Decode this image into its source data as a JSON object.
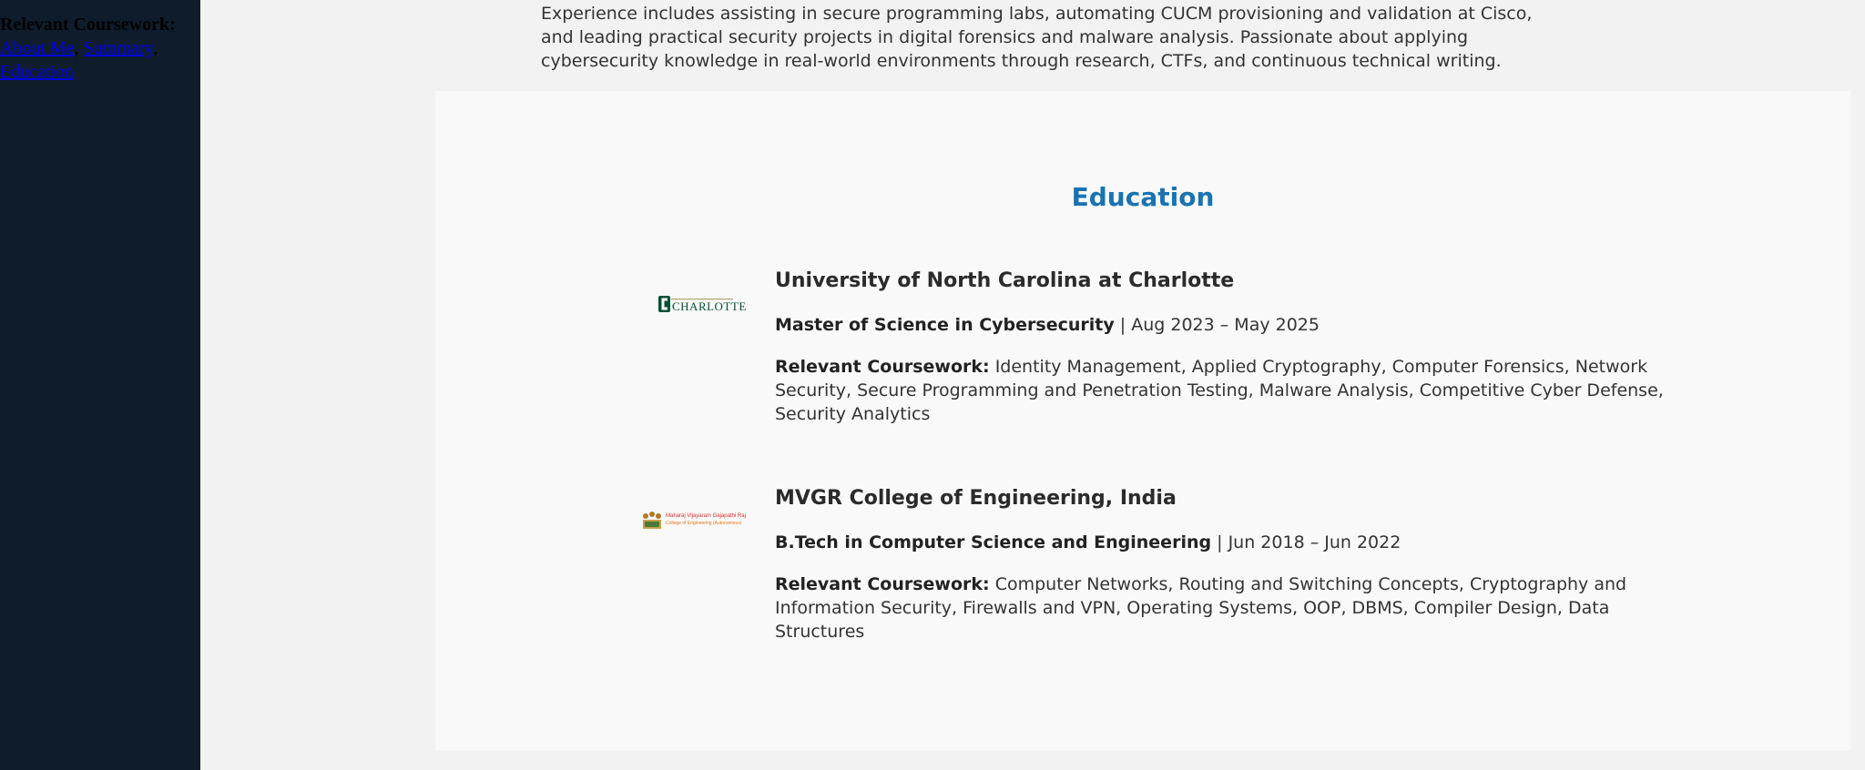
{
  "sidebar": {
    "heading": "Relevant Coursework:",
    "links": [
      {
        "label": "About Me"
      },
      {
        "label": "Summary"
      },
      {
        "label": "Education"
      }
    ],
    "separator": ","
  },
  "summary": {
    "text_tail": "Experience includes assisting in secure programming labs, automating CUCM provisioning and validation at Cisco, and leading practical security projects in digital forensics and malware analysis. Passionate about applying cybersecurity knowledge in real-world environments through research, CTFs, and continuous technical writing."
  },
  "education": {
    "title": "Education",
    "entries": [
      {
        "logo_text": "CHARLOTTE",
        "school": "University of North Carolina at Charlotte",
        "degree": "Master of Science in Cybersecurity",
        "dates": "| Aug 2023 – May 2025",
        "coursework_label": "Relevant Coursework:",
        "coursework": "Identity Management, Applied Cryptography, Computer Forensics, Network Security, Secure Programming and Penetration Testing, Malware Analysis, Competitive Cyber Defense, Security Analytics"
      },
      {
        "logo_text_line1": "Maharaj Vijayaram Gajapathi Raj",
        "logo_text_line2": "College of Engineering (Autonomous)",
        "school": "MVGR College of Engineering, India",
        "degree": "B.Tech in Computer Science and Engineering",
        "dates": "| Jun 2018 – Jun 2022",
        "coursework_label": "Relevant Coursework:",
        "coursework": "Computer Networks, Routing and Switching Concepts, Cryptography and Information Security, Firewalls and VPN, Operating Systems, OOP, DBMS, Compiler Design, Data Structures"
      }
    ]
  },
  "colors": {
    "sidebar_bg": "#0f1c2b",
    "accent": "#1a73b0",
    "page_bg": "#f2f2f2",
    "section_bg": "#f9f9f9",
    "charlotte_green": "#005035"
  }
}
